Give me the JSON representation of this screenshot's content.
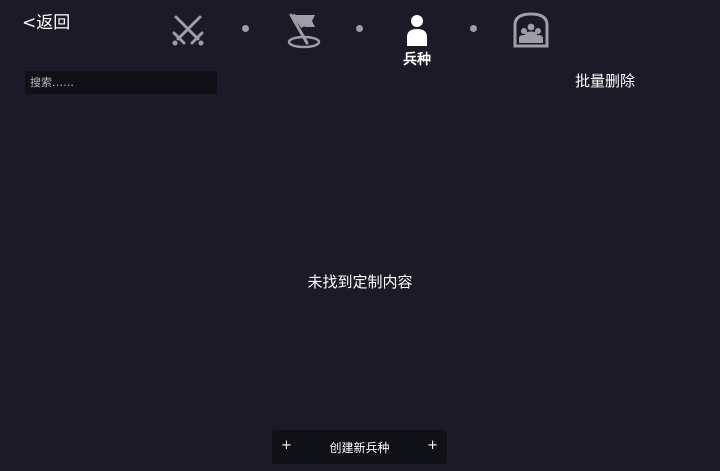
{
  "header": {
    "back_label": "<返回",
    "tabs": [
      {
        "icon": "crossed-swords-icon",
        "label": "",
        "active": false
      },
      {
        "icon": "flag-icon",
        "label": "",
        "active": false
      },
      {
        "icon": "person-icon",
        "label": "兵种",
        "active": true
      },
      {
        "icon": "group-icon",
        "label": "",
        "active": false
      }
    ]
  },
  "toolbar": {
    "search_placeholder": "搜索……",
    "batch_delete_label": "批量删除"
  },
  "main": {
    "empty_message": "未找到定制内容"
  },
  "footer": {
    "create_label": "创建新兵种",
    "plus_left": "+",
    "plus_right": "+"
  },
  "colors": {
    "background": "#1b1a26",
    "inactive_icon": "#9e9ea6",
    "active_icon": "#ffffff",
    "input_bg": "#101017"
  }
}
